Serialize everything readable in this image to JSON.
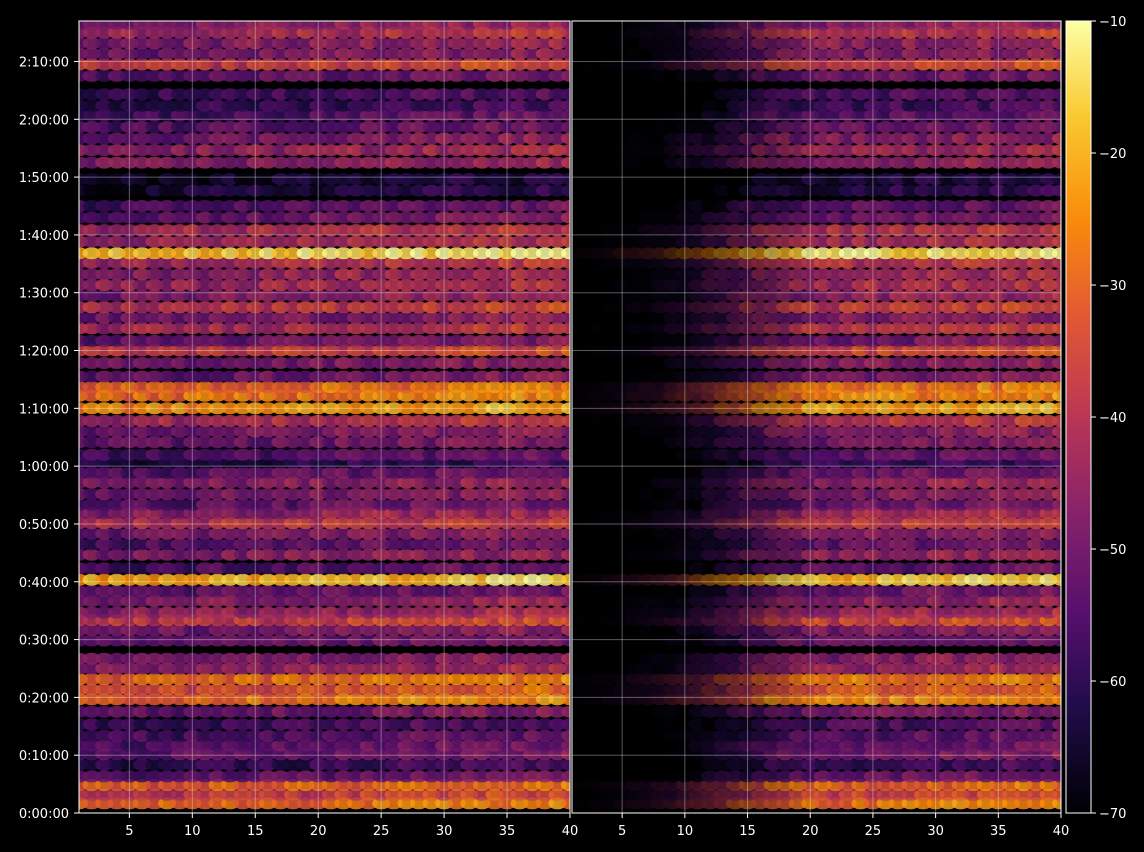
{
  "chart_data": {
    "type": "heatmap",
    "title": "",
    "xlabel": "",
    "ylabel": "",
    "panels": [
      {
        "name": "",
        "xlim": [
          1,
          40
        ],
        "xticks": [
          5,
          10,
          15,
          20,
          25,
          30,
          35,
          40
        ],
        "x_left_fade": false
      },
      {
        "name": "",
        "xlim": [
          1,
          40
        ],
        "xticks": [
          5,
          10,
          15,
          20,
          25,
          30,
          35,
          40
        ],
        "x_left_fade": true
      }
    ],
    "y_axis": {
      "unit": "seconds",
      "ylim": [
        0,
        8220
      ],
      "tick_values": [
        0,
        600,
        1200,
        1800,
        2400,
        3000,
        3600,
        4200,
        4800,
        5400,
        6000,
        6600,
        7200,
        7800
      ],
      "tick_labels": [
        "0:00:00",
        "0:10:00",
        "0:20:00",
        "0:30:00",
        "0:40:00",
        "0:50:00",
        "1:00:00",
        "1:10:00",
        "1:20:00",
        "1:30:00",
        "1:40:00",
        "1:50:00",
        "2:00:00",
        "2:10:00"
      ]
    },
    "colorbar": {
      "colormap": "inferno",
      "range": [
        -70,
        -10
      ],
      "ticks": [
        -70,
        -60,
        -50,
        -40,
        -30,
        -20,
        -10
      ],
      "tick_labels": [
        "−70",
        "−60",
        "−50",
        "−40",
        "−30",
        "−20",
        "−10"
      ]
    },
    "grid": true,
    "background_color": "#000000",
    "bands": [
      {
        "t": 100,
        "db": -28
      },
      {
        "t": 190,
        "db": -36
      },
      {
        "t": 290,
        "db": -30
      },
      {
        "t": 380,
        "db": -52
      },
      {
        "t": 500,
        "db": -58
      },
      {
        "t": 610,
        "db": -50
      },
      {
        "t": 700,
        "db": -52
      },
      {
        "t": 800,
        "db": -54
      },
      {
        "t": 920,
        "db": -56
      },
      {
        "t": 1050,
        "db": -50
      },
      {
        "t": 1180,
        "db": -26
      },
      {
        "t": 1280,
        "db": -32
      },
      {
        "t": 1390,
        "db": -28
      },
      {
        "t": 1500,
        "db": -44
      },
      {
        "t": 1600,
        "db": -48
      },
      {
        "t": 1790,
        "db": -52
      },
      {
        "t": 1900,
        "db": -48
      },
      {
        "t": 2000,
        "db": -36
      },
      {
        "t": 2080,
        "db": -44
      },
      {
        "t": 2200,
        "db": -46
      },
      {
        "t": 2300,
        "db": -52
      },
      {
        "t": 2420,
        "db": -18
      },
      {
        "t": 2540,
        "db": -54
      },
      {
        "t": 2680,
        "db": -46
      },
      {
        "t": 2790,
        "db": -52
      },
      {
        "t": 2900,
        "db": -48
      },
      {
        "t": 3010,
        "db": -38
      },
      {
        "t": 3110,
        "db": -44
      },
      {
        "t": 3200,
        "db": -52
      },
      {
        "t": 3310,
        "db": -48
      },
      {
        "t": 3430,
        "db": -46
      },
      {
        "t": 3530,
        "db": -52
      },
      {
        "t": 3640,
        "db": -60
      },
      {
        "t": 3720,
        "db": -54
      },
      {
        "t": 3850,
        "db": -50
      },
      {
        "t": 3960,
        "db": -48
      },
      {
        "t": 4070,
        "db": -40
      },
      {
        "t": 4200,
        "db": -22
      },
      {
        "t": 4330,
        "db": -26
      },
      {
        "t": 4420,
        "db": -28
      },
      {
        "t": 4530,
        "db": -50
      },
      {
        "t": 4670,
        "db": -48
      },
      {
        "t": 4800,
        "db": -36
      },
      {
        "t": 4900,
        "db": -50
      },
      {
        "t": 5030,
        "db": -40
      },
      {
        "t": 5140,
        "db": -48
      },
      {
        "t": 5250,
        "db": -38
      },
      {
        "t": 5370,
        "db": -46
      },
      {
        "t": 5480,
        "db": -42
      },
      {
        "t": 5590,
        "db": -44
      },
      {
        "t": 5710,
        "db": -40
      },
      {
        "t": 5810,
        "db": -14
      },
      {
        "t": 5930,
        "db": -42
      },
      {
        "t": 6050,
        "db": -40
      },
      {
        "t": 6180,
        "db": -50
      },
      {
        "t": 6300,
        "db": -54
      },
      {
        "t": 6460,
        "db": -62
      },
      {
        "t": 6580,
        "db": -64
      },
      {
        "t": 6750,
        "db": -46
      },
      {
        "t": 6880,
        "db": -44
      },
      {
        "t": 7000,
        "db": -48
      },
      {
        "t": 7120,
        "db": -52
      },
      {
        "t": 7240,
        "db": -54
      },
      {
        "t": 7340,
        "db": -58
      },
      {
        "t": 7460,
        "db": -56
      },
      {
        "t": 7650,
        "db": -52
      },
      {
        "t": 7770,
        "db": -36
      },
      {
        "t": 7880,
        "db": -48
      },
      {
        "t": 7990,
        "db": -46
      },
      {
        "t": 8100,
        "db": -40
      },
      {
        "t": 8190,
        "db": -46
      }
    ]
  }
}
